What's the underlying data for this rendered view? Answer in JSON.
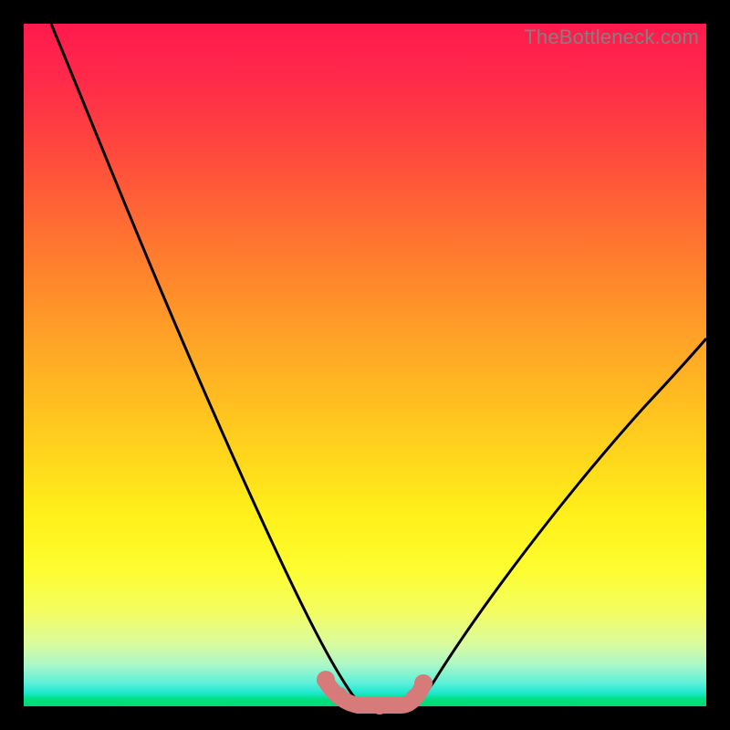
{
  "watermark": "TheBottleneck.com",
  "chart_data": {
    "type": "line",
    "title": "",
    "xlabel": "",
    "ylabel": "",
    "xlim": [
      0,
      100
    ],
    "ylim": [
      0,
      100
    ],
    "series": [
      {
        "name": "left-curve",
        "x": [
          4,
          10,
          16,
          22,
          28,
          34,
          40,
          44,
          47,
          49,
          50
        ],
        "values": [
          100,
          84,
          68,
          52,
          37,
          24,
          12,
          5,
          1,
          0,
          0
        ]
      },
      {
        "name": "right-curve",
        "x": [
          56,
          58,
          62,
          68,
          74,
          80,
          86,
          92,
          98,
          100
        ],
        "values": [
          0,
          1,
          5,
          12,
          20,
          29,
          38,
          47,
          55,
          58
        ]
      },
      {
        "name": "marker-band",
        "x": [
          44,
          45,
          46,
          47,
          49,
          51,
          53,
          55,
          56,
          57
        ],
        "values": [
          3,
          2,
          1.2,
          0.6,
          0.2,
          0.2,
          0.2,
          0.6,
          1.5,
          3
        ]
      }
    ],
    "colors": {
      "curve": "#000000",
      "marker": "#d77a7a",
      "gradient_top": "#ff1a4d",
      "gradient_bottom": "#00d870"
    }
  }
}
